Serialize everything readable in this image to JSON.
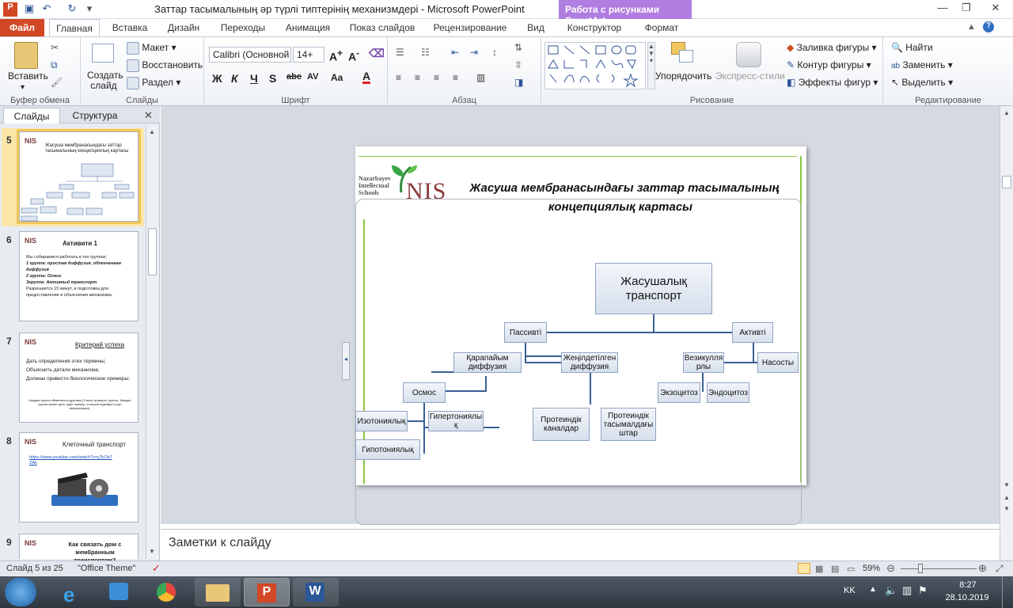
{
  "window": {
    "title": "Заттар тасымалының әр түрлі типтерінің механизмдері  -  Microsoft PowerPoint",
    "context_tab": "Работа с рисунками SmartArt"
  },
  "tabs": [
    "Файл",
    "Главная",
    "Вставка",
    "Дизайн",
    "Переходы",
    "Анимация",
    "Показ слайдов",
    "Рецензирование",
    "Вид",
    "Конструктор",
    "Формат"
  ],
  "ribbon": {
    "clipboard": {
      "label": "Буфер обмена",
      "paste": "Вставить"
    },
    "slides": {
      "label": "Слайды",
      "new_slide": "Создать слайд",
      "layout": "Макет",
      "reset": "Восстановить",
      "section": "Раздел"
    },
    "font": {
      "label": "Шрифт",
      "font_name": "Calibri (Основной",
      "font_size": "14+"
    },
    "paragraph": {
      "label": "Абзац"
    },
    "drawing": {
      "label": "Рисование",
      "arrange": "Упорядочить",
      "quick_styles": "Экспресс-стили",
      "fill": "Заливка фигуры",
      "outline": "Контур фигуры",
      "effects": "Эффекты фигур"
    },
    "editing": {
      "label": "Редактирование",
      "find": "Найти",
      "replace": "Заменить",
      "select": "Выделить"
    }
  },
  "panel": {
    "tab_slides": "Слайды",
    "tab_outline": "Структура",
    "thumbnails": [
      {
        "num": "5",
        "title": "Жасуша мембранасындағы заттар тасымалының концепциялық картасы"
      },
      {
        "num": "6",
        "title": "Активити  1",
        "bullets": [
          "Мы собираемся  работать в тех группах;",
          "1 группа: простая диффузия, облегченная диффузия",
          "2 группа: Осмос",
          "3группа: Активный транспорт",
          "Разрешается  15 минут, и подготовка для предоставления и объяснения  механизма."
        ]
      },
      {
        "num": "7",
        "title": "Критерий  успеха",
        "bullets": [
          "Дать определения    этих термины;",
          "Объяснить    детали механизма;",
          "Должны привести    биологические примеры;"
        ],
        "note": "Каждая группа обменяется другими (3 мин) проверят группы. Каждая группа может дать  один пример, который подойдет (сорт информации)."
      },
      {
        "num": "8",
        "title": "Клеточный транспорт",
        "link": "https://www.youtube.com/watch?v=yTcOb7ZAk"
      },
      {
        "num": "9",
        "title": "Как связать дом с мембранным  транспортом?"
      }
    ]
  },
  "slide": {
    "logo_text": "Nazarbayev Intellectual Schools",
    "logo_mark": "NIS",
    "title_line1": "Жасуша мембранасындағы заттар тасымалының",
    "title_line2": "концепциялық картасы",
    "nodes": {
      "root": "Жасушалық транспорт",
      "passive": "Пассивті",
      "active": "Активті",
      "simple": "Қарапайым диффузия",
      "facilitated": "Жеңілдетілген диффузия",
      "vesicular": "Везикулля рлы",
      "pumps": "Насосты",
      "osmosis": "Осмос",
      "exo": "Экзоцитоз",
      "endo": "Эндоцитоз",
      "iso": "Изотониялық",
      "hyper": "Гипертониялы қ",
      "channels": "Протеиндік каналдар",
      "carriers": "Протеиндік тасымалдағы штар",
      "hypo": "Гипотониялық"
    }
  },
  "notes": "Заметки к слайду",
  "status": {
    "slide_of": "Слайд 5 из 25",
    "theme": "\"Office Theme\"",
    "zoom": "59%"
  },
  "taskbar": {
    "lang": "KK",
    "time": "8:27",
    "date": "28.10.2019"
  },
  "colors": {
    "file_tab": "#d24726",
    "context_tab": "#b07de0",
    "node_fill": "#dbe3ef",
    "connector": "#3a5f95"
  }
}
